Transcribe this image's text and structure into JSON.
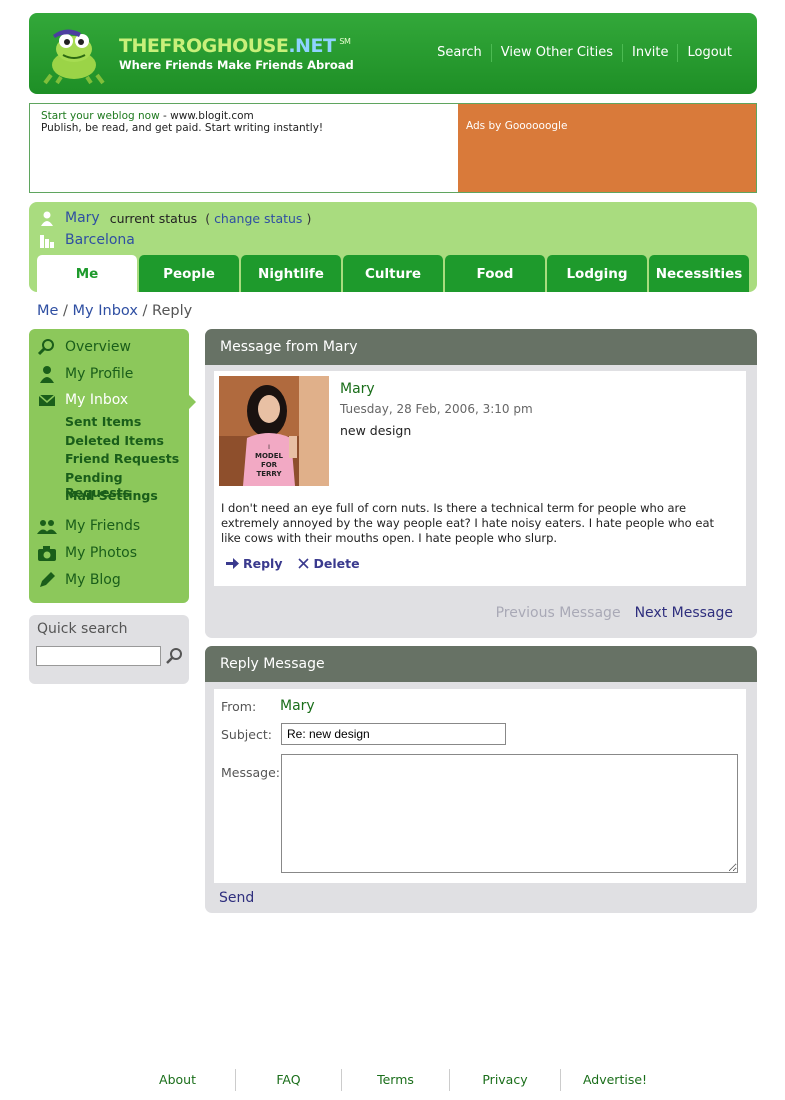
{
  "brand": {
    "name_main": "THEFROGHOUSE",
    "name_suffix": ".NET",
    "sm": "SM",
    "tagline": "Where Friends Make Friends Abroad"
  },
  "top_nav": [
    "Search",
    "View Other Cities",
    "Invite",
    "Logout"
  ],
  "ad": {
    "link_text": "Start your weblog now",
    "domain": " - www.blogit.com",
    "body": "Publish, be read, and get paid. Start writing instantly!",
    "ads_by": "Ads by Goooooogle",
    "color": "#d97a3a"
  },
  "status": {
    "user": "Mary",
    "label": "current status",
    "open_paren": "(",
    "change": "change status",
    "close_paren": ")",
    "city": "Barcelona"
  },
  "tabs": [
    "Me",
    "People",
    "Nightlife",
    "Culture",
    "Food",
    "Lodging",
    "Necessities"
  ],
  "breadcrumb": {
    "me": "Me",
    "sep1": " / ",
    "inbox": "My Inbox",
    "sep2": " / ",
    "current": "Reply"
  },
  "sidebar": {
    "overview": "Overview",
    "profile": "My Profile",
    "inbox": "My Inbox",
    "sub": [
      "Sent Items",
      "Deleted Items",
      "Friend Requests",
      "Pending Requests",
      "Mail Settings"
    ],
    "friends": "My Friends",
    "photos": "My Photos",
    "blog": "My Blog"
  },
  "quick_search": {
    "label": "Quick search",
    "value": ""
  },
  "message": {
    "panel_title": "Message from Mary",
    "from": "Mary",
    "date": "Tuesday, 28 Feb, 2006, 3:10 pm",
    "subject": "new design",
    "body": "I don't need an eye full of corn nuts. Is there a technical term for people who are extremely annoyed by the way people eat? I hate noisy eaters. I hate people who eat like cows with their mouths open. I hate people who slurp.",
    "reply": "Reply",
    "delete": "Delete",
    "prev": "Previous Message",
    "next": "Next Message",
    "shirt_text": [
      "I",
      "MODEL",
      "FOR",
      "TERRY"
    ]
  },
  "reply": {
    "panel_title": "Reply Message",
    "from_label": "From:",
    "from_value": "Mary",
    "subject_label": "Subject:",
    "subject_value": "Re: new design",
    "message_label": "Message:",
    "message_value": "",
    "send": "Send"
  },
  "footer": [
    "About",
    "FAQ",
    "Terms",
    "Privacy",
    "Advertise!"
  ]
}
